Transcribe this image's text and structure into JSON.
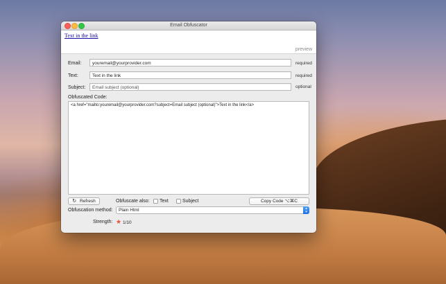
{
  "window": {
    "title": "Email Obfuscator"
  },
  "preview": {
    "link_text": "Text in the link",
    "label": "preview"
  },
  "form": {
    "email": {
      "label": "Email:",
      "value": "youremail@yourprovider.com",
      "note": "required"
    },
    "text": {
      "label": "Text:",
      "value": "Text in the link",
      "note": "required"
    },
    "subject": {
      "label": "Subject:",
      "placeholder": "Email subject (optional)",
      "note": "optional"
    }
  },
  "code": {
    "label": "Obfuscated Code:",
    "value": "<a href=\"mailto:youremail@yourprovider.com?subject=Email subject (optional)\">Text in the link</a>"
  },
  "controls": {
    "refresh_icon": "refresh-icon",
    "refresh_label": "Refresh",
    "obfuscate_also_label": "Obfuscate also:",
    "text_option": {
      "label": "Text",
      "checked": false
    },
    "subject_option": {
      "label": "Subject",
      "checked": false
    },
    "copy_label": "Copy Code  ⌥⌘C",
    "method_label": "Obfuscation method:",
    "method_value": "Plain Html",
    "strength_label": "Strength:",
    "strength_value": "1/10",
    "strength_level": 1
  },
  "colors": {
    "accent": "#1b6fe8",
    "star": "#e8523c",
    "link": "#1a0dab"
  }
}
